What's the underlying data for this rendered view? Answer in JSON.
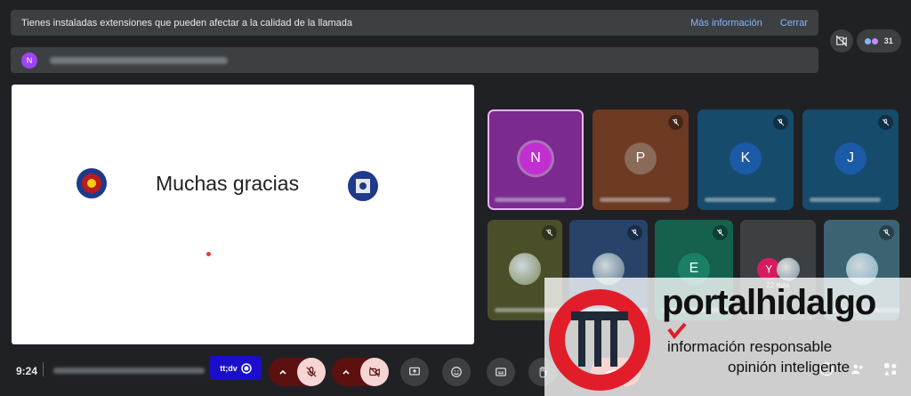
{
  "notice": {
    "message": "Tienes instaladas extensiones que pueden afectar a la calidad de la llamada",
    "more_info": "Más información",
    "close": "Cerrar"
  },
  "meeting_row": {
    "avatar_letter": "N"
  },
  "people": {
    "count": "31"
  },
  "slide": {
    "title": "Muchas gracias"
  },
  "tiles": [
    {
      "letter": "N",
      "bg": "#7b2a8f",
      "avatar_bg": "#c22fd1",
      "highlight": true
    },
    {
      "letter": "P",
      "bg": "#6d3a23",
      "avatar_bg": "#8a6a58"
    },
    {
      "letter": "K",
      "bg": "#174b6b",
      "avatar_bg": "#1a5aa6"
    },
    {
      "letter": "J",
      "bg": "#174b6b",
      "avatar_bg": "#1a5aa6"
    },
    {
      "letter": "",
      "bg": "#4a4f2a",
      "photo": "#7b8a5a"
    },
    {
      "letter": "",
      "bg": "#27436a",
      "photo": "#5a7590"
    },
    {
      "letter": "E",
      "bg": "#15614e",
      "avatar_bg": "#1a8065"
    },
    {
      "letter": "Y",
      "bg": "#3c4043",
      "avatar_bg": "#d81b60",
      "more": "22 más"
    },
    {
      "letter": "",
      "bg": "#3c6372",
      "photo": "#7fb0c0"
    }
  ],
  "bottom": {
    "time": "9:24",
    "captions_label": "tt;dv"
  },
  "watermark": {
    "brand": "portalhidalgo",
    "tagline1": "información responsable",
    "tagline2": "opinión inteligente"
  },
  "colors": {
    "accent_link": "#8ab4f8",
    "danger": "#ea4335",
    "mic_off_group": "#5c1010"
  }
}
